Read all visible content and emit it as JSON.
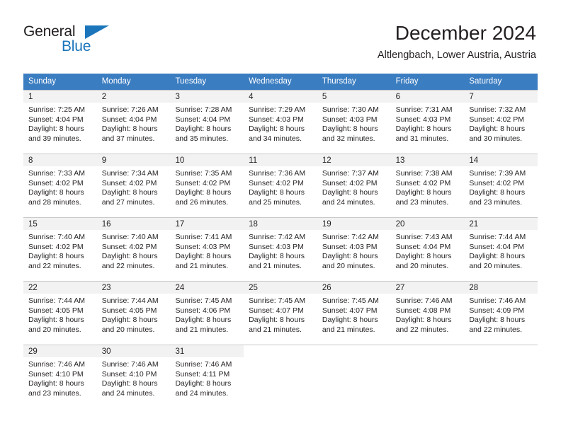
{
  "brand": {
    "name_dark": "General",
    "name_blue": "Blue",
    "triangle_color": "#1b75bb"
  },
  "header": {
    "title": "December 2024",
    "subtitle": "Altlengbach, Lower Austria, Austria"
  },
  "theme": {
    "header_blue": "#3b7dc1",
    "day_band": "#f2f2f2",
    "grid_line": "#c9c9c9",
    "text": "#231f20"
  },
  "weekdays": [
    "Sunday",
    "Monday",
    "Tuesday",
    "Wednesday",
    "Thursday",
    "Friday",
    "Saturday"
  ],
  "weeks": [
    [
      {
        "day": "1",
        "sunrise": "Sunrise: 7:25 AM",
        "sunset": "Sunset: 4:04 PM",
        "daylight1": "Daylight: 8 hours",
        "daylight2": "and 39 minutes."
      },
      {
        "day": "2",
        "sunrise": "Sunrise: 7:26 AM",
        "sunset": "Sunset: 4:04 PM",
        "daylight1": "Daylight: 8 hours",
        "daylight2": "and 37 minutes."
      },
      {
        "day": "3",
        "sunrise": "Sunrise: 7:28 AM",
        "sunset": "Sunset: 4:04 PM",
        "daylight1": "Daylight: 8 hours",
        "daylight2": "and 35 minutes."
      },
      {
        "day": "4",
        "sunrise": "Sunrise: 7:29 AM",
        "sunset": "Sunset: 4:03 PM",
        "daylight1": "Daylight: 8 hours",
        "daylight2": "and 34 minutes."
      },
      {
        "day": "5",
        "sunrise": "Sunrise: 7:30 AM",
        "sunset": "Sunset: 4:03 PM",
        "daylight1": "Daylight: 8 hours",
        "daylight2": "and 32 minutes."
      },
      {
        "day": "6",
        "sunrise": "Sunrise: 7:31 AM",
        "sunset": "Sunset: 4:03 PM",
        "daylight1": "Daylight: 8 hours",
        "daylight2": "and 31 minutes."
      },
      {
        "day": "7",
        "sunrise": "Sunrise: 7:32 AM",
        "sunset": "Sunset: 4:02 PM",
        "daylight1": "Daylight: 8 hours",
        "daylight2": "and 30 minutes."
      }
    ],
    [
      {
        "day": "8",
        "sunrise": "Sunrise: 7:33 AM",
        "sunset": "Sunset: 4:02 PM",
        "daylight1": "Daylight: 8 hours",
        "daylight2": "and 28 minutes."
      },
      {
        "day": "9",
        "sunrise": "Sunrise: 7:34 AM",
        "sunset": "Sunset: 4:02 PM",
        "daylight1": "Daylight: 8 hours",
        "daylight2": "and 27 minutes."
      },
      {
        "day": "10",
        "sunrise": "Sunrise: 7:35 AM",
        "sunset": "Sunset: 4:02 PM",
        "daylight1": "Daylight: 8 hours",
        "daylight2": "and 26 minutes."
      },
      {
        "day": "11",
        "sunrise": "Sunrise: 7:36 AM",
        "sunset": "Sunset: 4:02 PM",
        "daylight1": "Daylight: 8 hours",
        "daylight2": "and 25 minutes."
      },
      {
        "day": "12",
        "sunrise": "Sunrise: 7:37 AM",
        "sunset": "Sunset: 4:02 PM",
        "daylight1": "Daylight: 8 hours",
        "daylight2": "and 24 minutes."
      },
      {
        "day": "13",
        "sunrise": "Sunrise: 7:38 AM",
        "sunset": "Sunset: 4:02 PM",
        "daylight1": "Daylight: 8 hours",
        "daylight2": "and 23 minutes."
      },
      {
        "day": "14",
        "sunrise": "Sunrise: 7:39 AM",
        "sunset": "Sunset: 4:02 PM",
        "daylight1": "Daylight: 8 hours",
        "daylight2": "and 23 minutes."
      }
    ],
    [
      {
        "day": "15",
        "sunrise": "Sunrise: 7:40 AM",
        "sunset": "Sunset: 4:02 PM",
        "daylight1": "Daylight: 8 hours",
        "daylight2": "and 22 minutes."
      },
      {
        "day": "16",
        "sunrise": "Sunrise: 7:40 AM",
        "sunset": "Sunset: 4:02 PM",
        "daylight1": "Daylight: 8 hours",
        "daylight2": "and 22 minutes."
      },
      {
        "day": "17",
        "sunrise": "Sunrise: 7:41 AM",
        "sunset": "Sunset: 4:03 PM",
        "daylight1": "Daylight: 8 hours",
        "daylight2": "and 21 minutes."
      },
      {
        "day": "18",
        "sunrise": "Sunrise: 7:42 AM",
        "sunset": "Sunset: 4:03 PM",
        "daylight1": "Daylight: 8 hours",
        "daylight2": "and 21 minutes."
      },
      {
        "day": "19",
        "sunrise": "Sunrise: 7:42 AM",
        "sunset": "Sunset: 4:03 PM",
        "daylight1": "Daylight: 8 hours",
        "daylight2": "and 20 minutes."
      },
      {
        "day": "20",
        "sunrise": "Sunrise: 7:43 AM",
        "sunset": "Sunset: 4:04 PM",
        "daylight1": "Daylight: 8 hours",
        "daylight2": "and 20 minutes."
      },
      {
        "day": "21",
        "sunrise": "Sunrise: 7:44 AM",
        "sunset": "Sunset: 4:04 PM",
        "daylight1": "Daylight: 8 hours",
        "daylight2": "and 20 minutes."
      }
    ],
    [
      {
        "day": "22",
        "sunrise": "Sunrise: 7:44 AM",
        "sunset": "Sunset: 4:05 PM",
        "daylight1": "Daylight: 8 hours",
        "daylight2": "and 20 minutes."
      },
      {
        "day": "23",
        "sunrise": "Sunrise: 7:44 AM",
        "sunset": "Sunset: 4:05 PM",
        "daylight1": "Daylight: 8 hours",
        "daylight2": "and 20 minutes."
      },
      {
        "day": "24",
        "sunrise": "Sunrise: 7:45 AM",
        "sunset": "Sunset: 4:06 PM",
        "daylight1": "Daylight: 8 hours",
        "daylight2": "and 21 minutes."
      },
      {
        "day": "25",
        "sunrise": "Sunrise: 7:45 AM",
        "sunset": "Sunset: 4:07 PM",
        "daylight1": "Daylight: 8 hours",
        "daylight2": "and 21 minutes."
      },
      {
        "day": "26",
        "sunrise": "Sunrise: 7:45 AM",
        "sunset": "Sunset: 4:07 PM",
        "daylight1": "Daylight: 8 hours",
        "daylight2": "and 21 minutes."
      },
      {
        "day": "27",
        "sunrise": "Sunrise: 7:46 AM",
        "sunset": "Sunset: 4:08 PM",
        "daylight1": "Daylight: 8 hours",
        "daylight2": "and 22 minutes."
      },
      {
        "day": "28",
        "sunrise": "Sunrise: 7:46 AM",
        "sunset": "Sunset: 4:09 PM",
        "daylight1": "Daylight: 8 hours",
        "daylight2": "and 22 minutes."
      }
    ],
    [
      {
        "day": "29",
        "sunrise": "Sunrise: 7:46 AM",
        "sunset": "Sunset: 4:10 PM",
        "daylight1": "Daylight: 8 hours",
        "daylight2": "and 23 minutes."
      },
      {
        "day": "30",
        "sunrise": "Sunrise: 7:46 AM",
        "sunset": "Sunset: 4:10 PM",
        "daylight1": "Daylight: 8 hours",
        "daylight2": "and 24 minutes."
      },
      {
        "day": "31",
        "sunrise": "Sunrise: 7:46 AM",
        "sunset": "Sunset: 4:11 PM",
        "daylight1": "Daylight: 8 hours",
        "daylight2": "and 24 minutes."
      },
      {
        "day": "",
        "sunrise": "",
        "sunset": "",
        "daylight1": "",
        "daylight2": ""
      },
      {
        "day": "",
        "sunrise": "",
        "sunset": "",
        "daylight1": "",
        "daylight2": ""
      },
      {
        "day": "",
        "sunrise": "",
        "sunset": "",
        "daylight1": "",
        "daylight2": ""
      },
      {
        "day": "",
        "sunrise": "",
        "sunset": "",
        "daylight1": "",
        "daylight2": ""
      }
    ]
  ]
}
